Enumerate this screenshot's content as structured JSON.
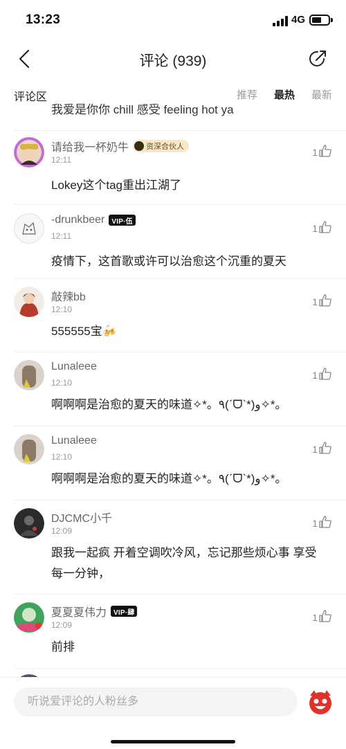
{
  "status": {
    "time": "13:23",
    "network": "4G"
  },
  "nav": {
    "title": "评论 (939)"
  },
  "tabs": {
    "section_label": "评论区",
    "sort": [
      "推荐",
      "最热",
      "最新"
    ],
    "active": "最热"
  },
  "clipped_text": "我爱是你你 chill 感受 feeling hot ya",
  "comments": [
    {
      "username": "请给我一杯奶牛",
      "badge": "资深合伙人",
      "time": "12:11",
      "likes": "1",
      "text": "Lokey这个tag重出江湖了",
      "avatar_color": "#c36ad6"
    },
    {
      "username": "-drunkbeer",
      "badge": "VIP·伍",
      "time": "12:11",
      "likes": "1",
      "text": "疫情下，这首歌或许可以治愈这个沉重的夏天",
      "avatar_color": "#e6e6e6"
    },
    {
      "username": "敲辣bb",
      "time": "12:10",
      "likes": "1",
      "text": "555555宝🍻",
      "avatar_color": "#b83a2d"
    },
    {
      "username": "Lunaleee",
      "time": "12:10",
      "likes": "1",
      "text": "啊啊啊是治愈的夏天的味道✧*。٩(ˊᗜˋ*)و✧*。",
      "avatar_color": "#8c7a66"
    },
    {
      "username": "Lunaleee",
      "time": "12:10",
      "likes": "1",
      "text": "啊啊啊是治愈的夏天的味道✧*。٩(ˊᗜˋ*)و✧*。",
      "avatar_color": "#8c7a66"
    },
    {
      "username": "DJCMC小千",
      "time": "12:09",
      "likes": "1",
      "text": "跟我一起疯 开着空调吹冷风，忘记那些烦心事 享受每一分钟，",
      "avatar_color": "#2b2b2b"
    },
    {
      "username": "夏夏夏伟力",
      "badge": "VIP·肆",
      "time": "12:09",
      "likes": "1",
      "text": "前排",
      "avatar_color": "#3fa35a"
    }
  ],
  "input": {
    "placeholder": "听说爱评论的人粉丝多"
  }
}
